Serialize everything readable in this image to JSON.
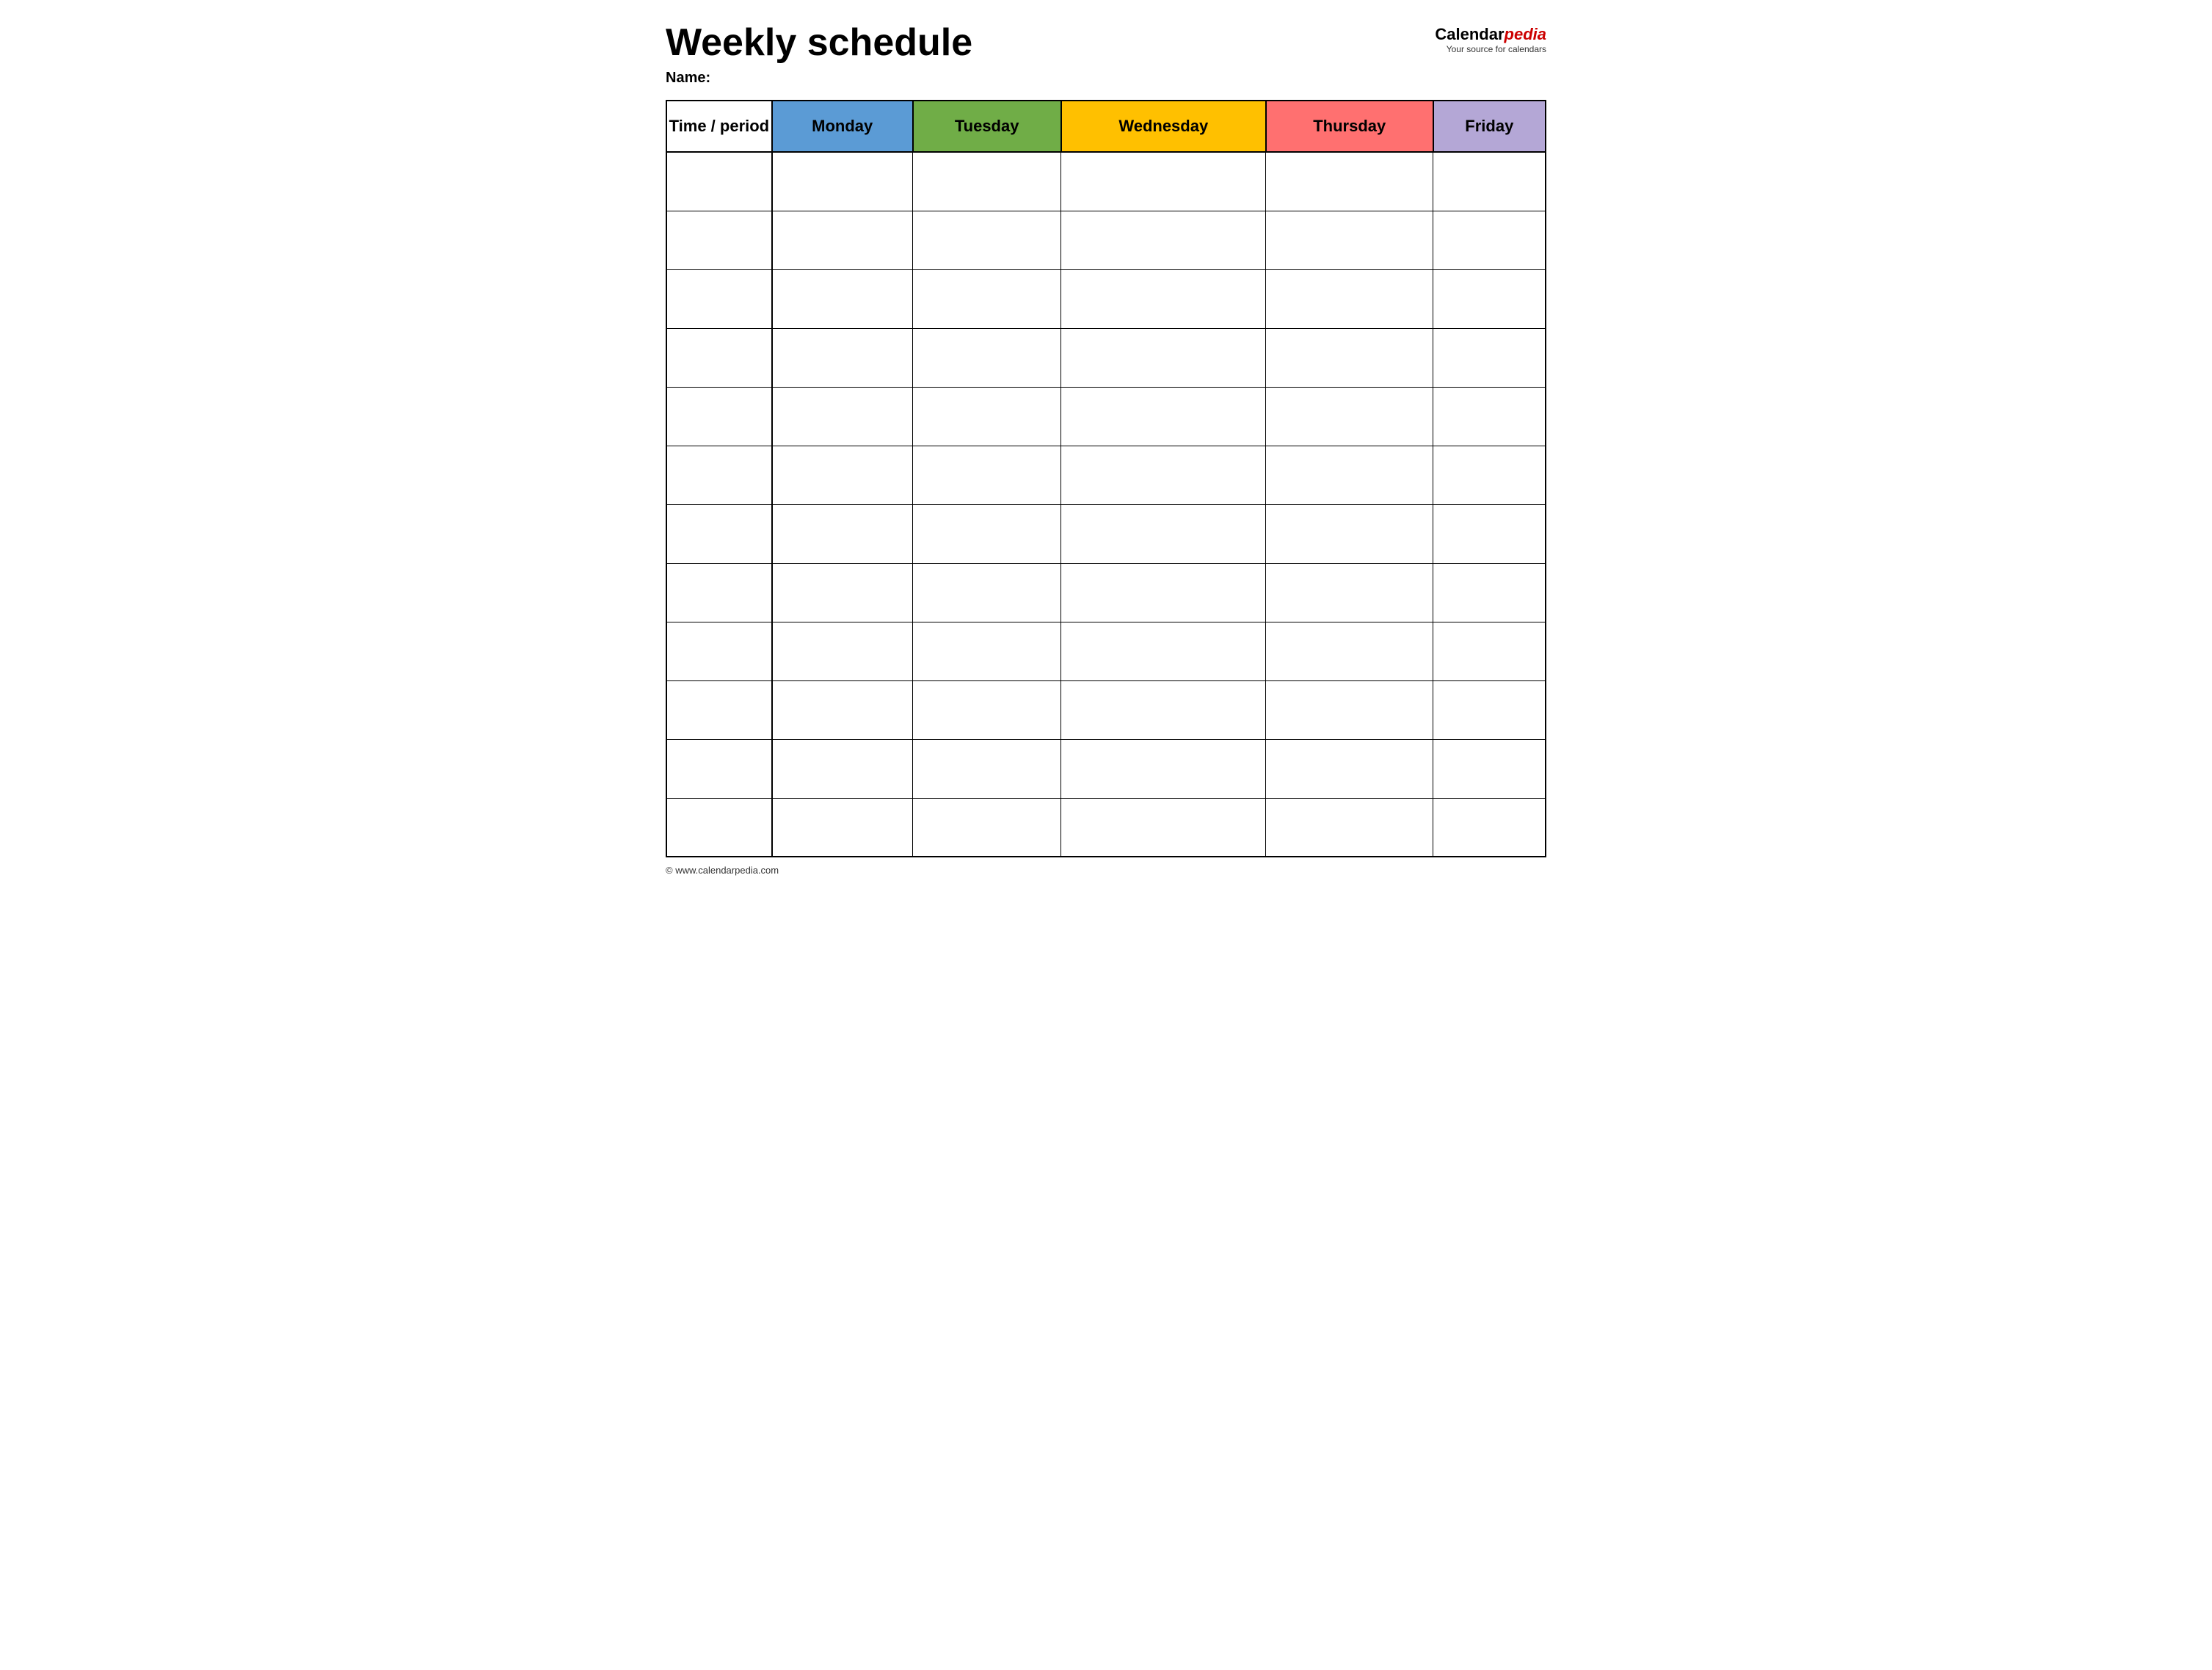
{
  "header": {
    "title": "Weekly schedule",
    "logo_name": "Calendar",
    "logo_name_italic": "pedia",
    "logo_tagline": "Your source for calendars"
  },
  "name_label": "Name:",
  "columns": [
    {
      "id": "time",
      "label": "Time / period",
      "color": "#ffffff",
      "text_color": "#000000"
    },
    {
      "id": "monday",
      "label": "Monday",
      "color": "#5b9bd5",
      "text_color": "#000000"
    },
    {
      "id": "tuesday",
      "label": "Tuesday",
      "color": "#70ad47",
      "text_color": "#000000"
    },
    {
      "id": "wednesday",
      "label": "Wednesday",
      "color": "#ffc000",
      "text_color": "#000000"
    },
    {
      "id": "thursday",
      "label": "Thursday",
      "color": "#ff7070",
      "text_color": "#000000"
    },
    {
      "id": "friday",
      "label": "Friday",
      "color": "#b4a7d6",
      "text_color": "#000000"
    }
  ],
  "rows": [
    {
      "id": 1
    },
    {
      "id": 2
    },
    {
      "id": 3
    },
    {
      "id": 4
    },
    {
      "id": 5
    },
    {
      "id": 6
    },
    {
      "id": 7
    },
    {
      "id": 8
    },
    {
      "id": 9
    },
    {
      "id": 10
    },
    {
      "id": 11
    },
    {
      "id": 12
    }
  ],
  "footer": {
    "copyright": "© www.calendarpedia.com"
  }
}
